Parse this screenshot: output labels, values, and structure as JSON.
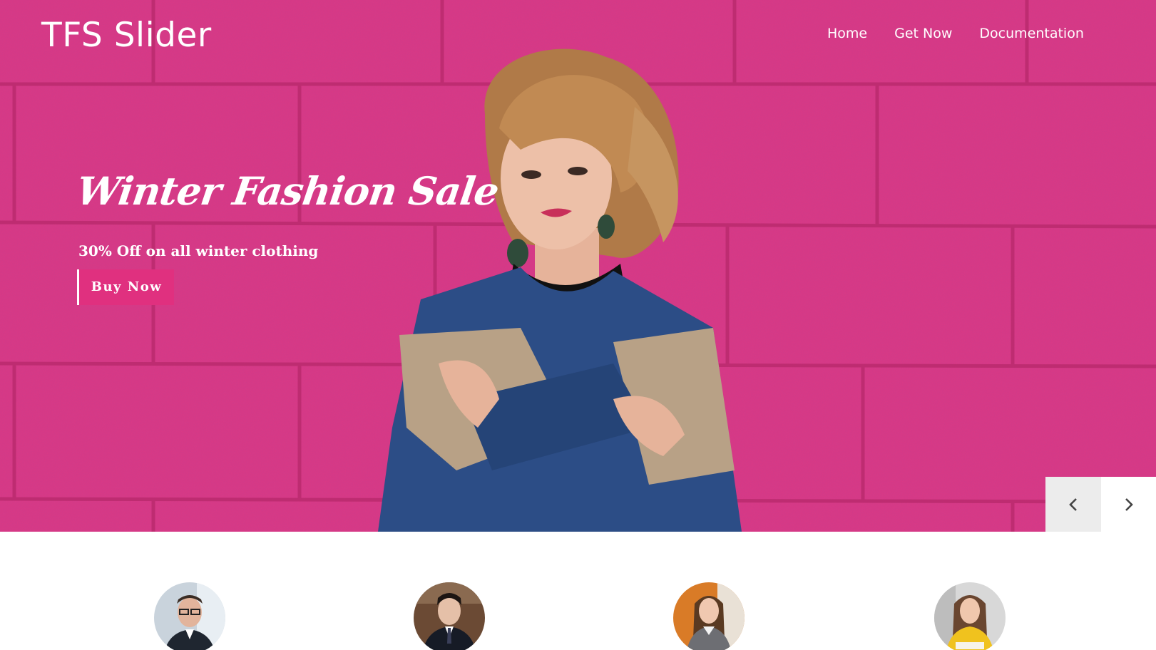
{
  "header": {
    "brand": "TFS Slider",
    "nav": [
      "Home",
      "Get Now",
      "Documentation"
    ]
  },
  "slide": {
    "headline": "Winter Fashion Sale",
    "subline": "30% Off on all winter clothing",
    "cta_label": "Buy Now",
    "background_color": "#de3a86"
  },
  "controls": {
    "prev_icon": "chevron-left-icon",
    "next_icon": "chevron-right-icon"
  },
  "team": {
    "avatars": [
      "avatar-man-glasses",
      "avatar-man-suit",
      "avatar-woman-orange",
      "avatar-woman-yellow"
    ]
  }
}
